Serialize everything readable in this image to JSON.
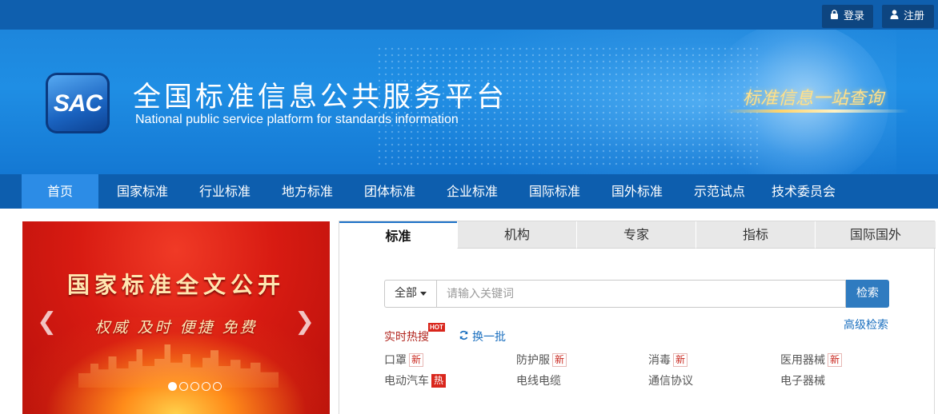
{
  "topbar": {
    "login_label": "登录",
    "register_label": "注册"
  },
  "header": {
    "logo_text": "SAC",
    "title": "全国标准信息公共服务平台",
    "subtitle": "National public service platform  for standards information",
    "slogan": "标准信息一站查询"
  },
  "nav": {
    "items": [
      "首页",
      "国家标准",
      "行业标准",
      "地方标准",
      "团体标准",
      "企业标准",
      "国际标准",
      "国外标准",
      "示范试点",
      "技术委员会"
    ],
    "active_index": 0
  },
  "carousel": {
    "title": "国家标准全文公开",
    "subtitle": "权威  及时  便捷  免费",
    "slide_count": 5,
    "active_slide": 1
  },
  "search": {
    "tabs": [
      "标准",
      "机构",
      "专家",
      "指标",
      "国际国外"
    ],
    "active_tab": 0,
    "scope_label": "全部",
    "placeholder": "请输入关键词",
    "value": "",
    "button_label": "检索",
    "advanced_label": "高级检索",
    "hot_label": "实时热搜",
    "hot_badge": "HOT",
    "refresh_label": "换一批",
    "keywords": [
      {
        "text": "口罩",
        "badge": "新",
        "badge_type": "new"
      },
      {
        "text": "防护服",
        "badge": "新",
        "badge_type": "new"
      },
      {
        "text": "消毒",
        "badge": "新",
        "badge_type": "new"
      },
      {
        "text": "医用器械",
        "badge": "新",
        "badge_type": "new"
      },
      {
        "text": "电动汽车",
        "badge": "热",
        "badge_type": "hot"
      },
      {
        "text": "电线电缆",
        "badge": "",
        "badge_type": ""
      },
      {
        "text": "通信协议",
        "badge": "",
        "badge_type": ""
      },
      {
        "text": "电子器械",
        "badge": "",
        "badge_type": ""
      }
    ]
  },
  "colors": {
    "nav_bg": "#0d5eae",
    "nav_active": "#2c8ce6",
    "search_button": "#2f7bc0",
    "hot_red": "#d9261c"
  }
}
